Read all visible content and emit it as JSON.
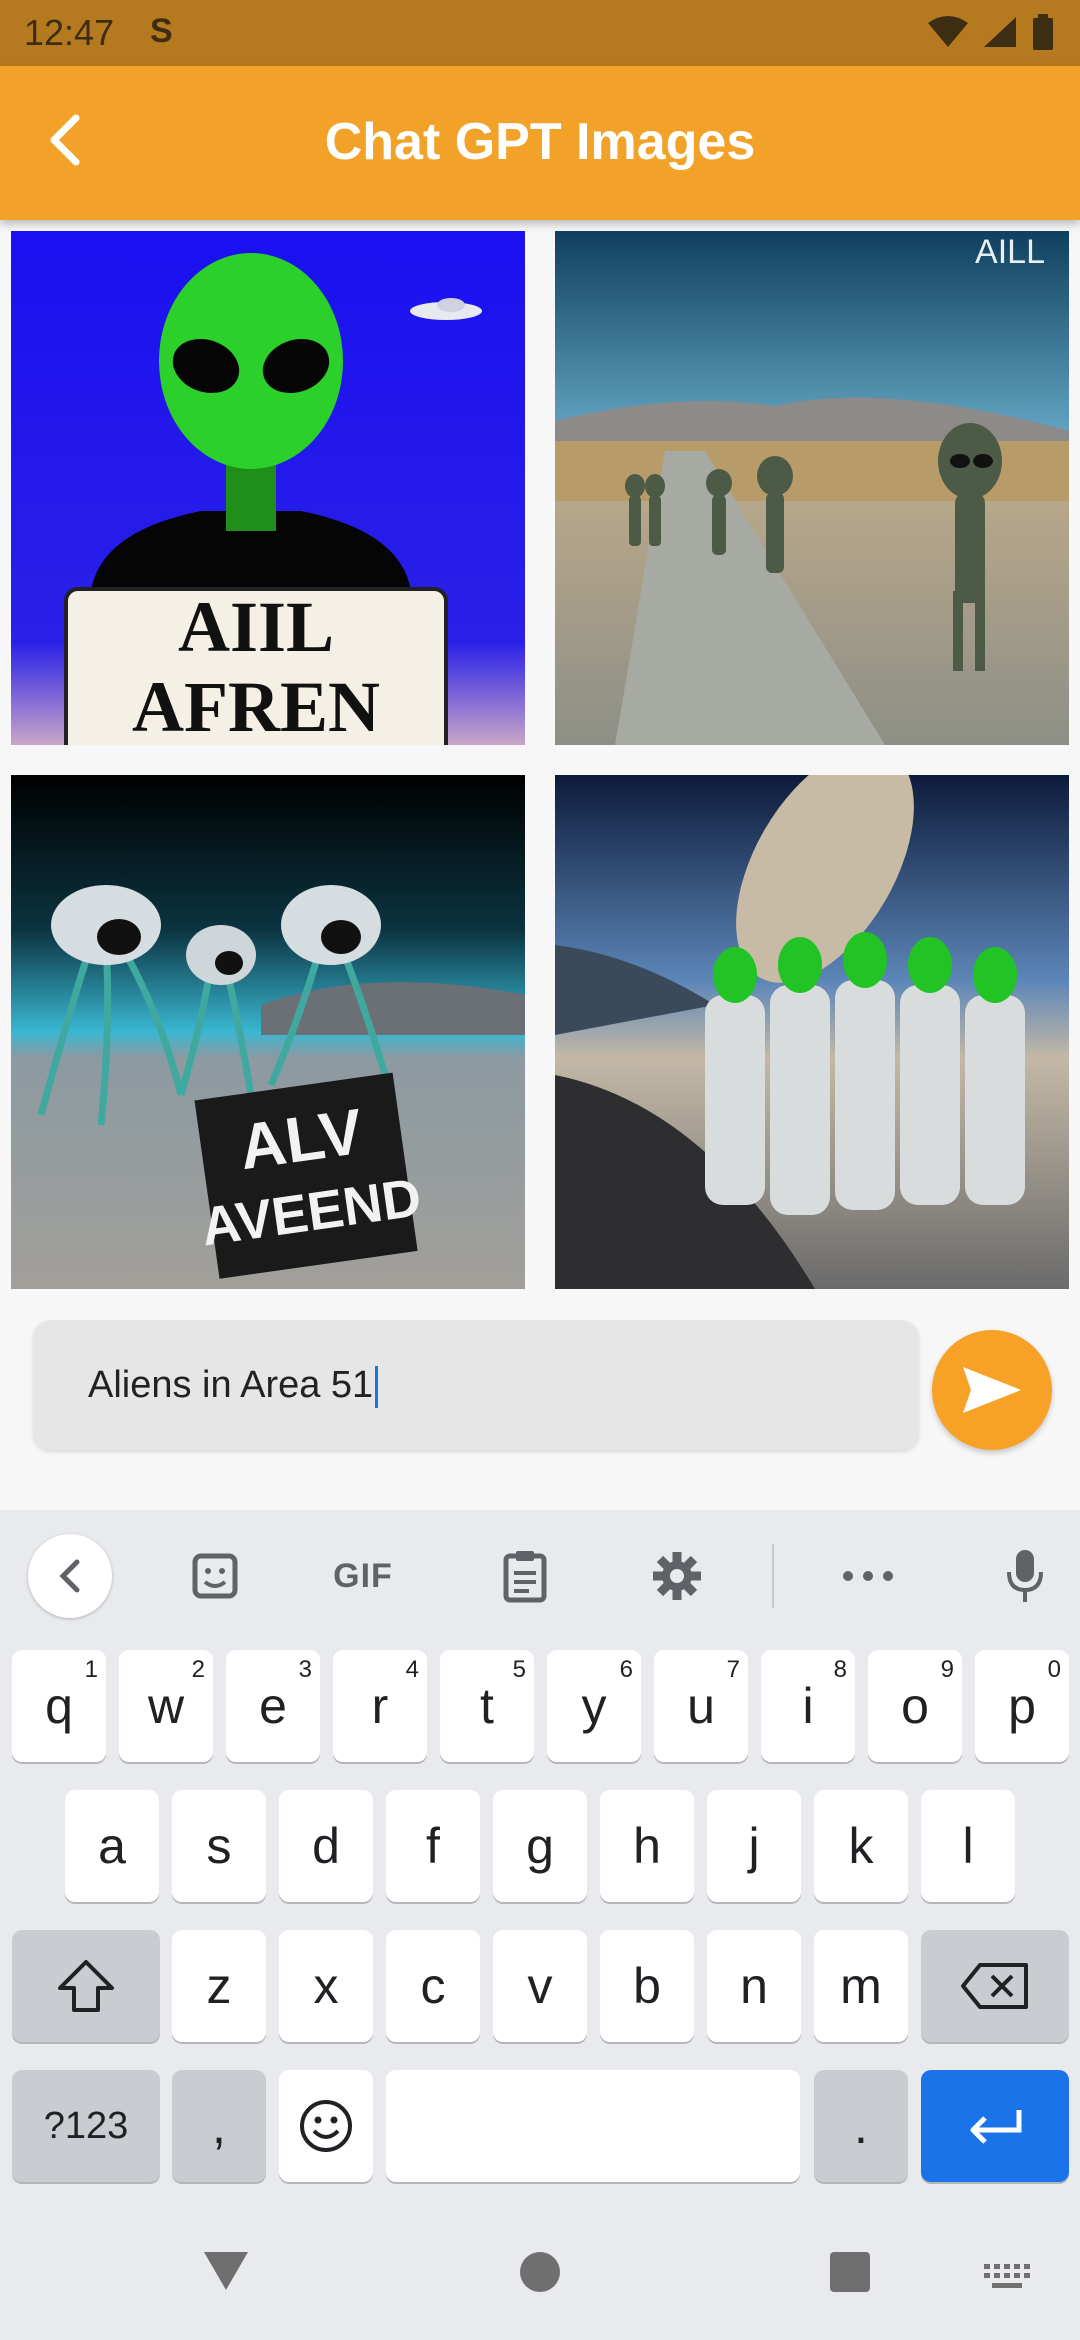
{
  "status_bar": {
    "time": "12:47",
    "s_icon": "S"
  },
  "app_bar": {
    "title": "Chat GPT Images",
    "back_icon": "chevron-left-icon"
  },
  "images": [
    {
      "sign_line1": "AIIL",
      "sign_line2": "AFREN"
    },
    {
      "sign_text": "AILL"
    },
    {
      "sign_line1": "ALV",
      "sign_line2": "AVEEND"
    },
    {
      "sign_text": ""
    }
  ],
  "prompt": {
    "value": "Aliens in Area 51"
  },
  "colors": {
    "accent": "#f2a129",
    "status_bar": "#b57a1f",
    "send": "#f7a227",
    "enter_key": "#1a73e8"
  },
  "keyboard": {
    "toolbar": {
      "gif_label": "GIF"
    },
    "row1": [
      {
        "label": "q",
        "hint": "1"
      },
      {
        "label": "w",
        "hint": "2"
      },
      {
        "label": "e",
        "hint": "3"
      },
      {
        "label": "r",
        "hint": "4"
      },
      {
        "label": "t",
        "hint": "5"
      },
      {
        "label": "y",
        "hint": "6"
      },
      {
        "label": "u",
        "hint": "7"
      },
      {
        "label": "i",
        "hint": "8"
      },
      {
        "label": "o",
        "hint": "9"
      },
      {
        "label": "p",
        "hint": "0"
      }
    ],
    "row2": [
      "a",
      "s",
      "d",
      "f",
      "g",
      "h",
      "j",
      "k",
      "l"
    ],
    "row3": [
      "z",
      "x",
      "c",
      "v",
      "b",
      "n",
      "m"
    ],
    "symbols_label": "?123",
    "comma_label": ",",
    "period_label": "."
  }
}
